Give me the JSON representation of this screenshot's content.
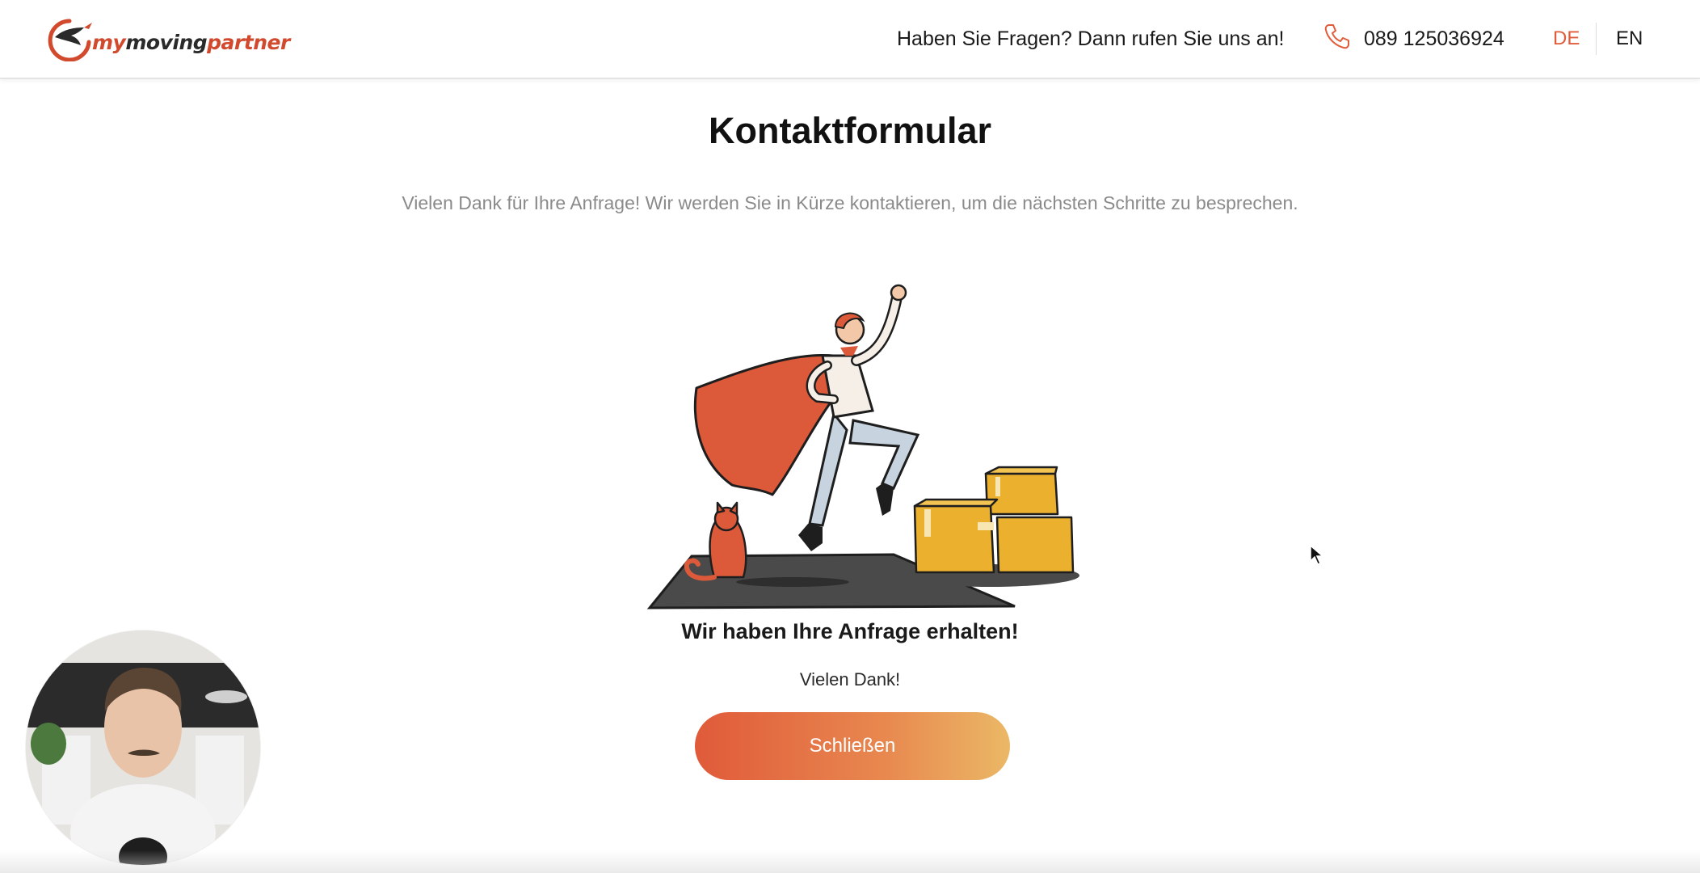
{
  "header": {
    "logo": {
      "my": "my",
      "moving": "moving",
      "partner": "partner"
    },
    "question": "Haben Sie Fragen? Dann rufen Sie uns an!",
    "phone_icon": "phone-icon",
    "phone_number": "089 125036924",
    "languages": [
      {
        "label": "DE",
        "active": true
      },
      {
        "label": "EN",
        "active": false
      }
    ]
  },
  "main": {
    "title": "Kontaktformular",
    "intro": "Vielen Dank für Ihre Anfrage! Wir werden Sie in Kürze kontaktieren, um die nächsten Schritte zu besprechen.",
    "illustration_icon": "superhero-moving-illustration",
    "received_heading": "Wir haben Ihre Anfrage erhalten!",
    "thanks_text": "Vielen Dank!",
    "close_label": "Schließen"
  },
  "colors": {
    "brand_orange": "#e05a3a",
    "button_gradient_end": "#ebb866",
    "active_language": "#e05c3a"
  }
}
